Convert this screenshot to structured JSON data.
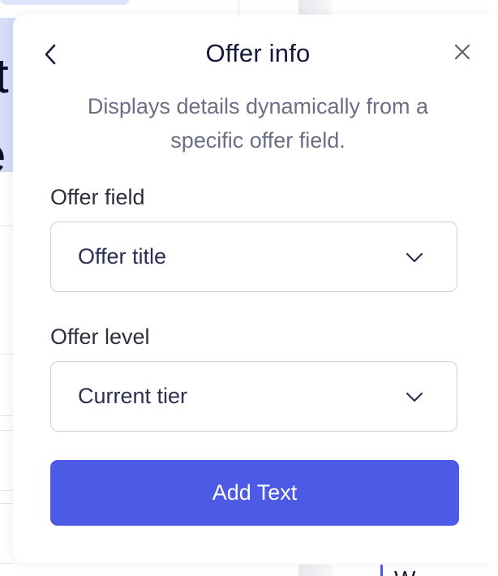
{
  "background": {
    "heading_fragment_1": "rt",
    "heading_fragment_2": "e",
    "bottom_fragment": "W"
  },
  "panel": {
    "title": "Offer info",
    "description": "Displays details dynamically from a specific offer field.",
    "back_icon": "chevron-left-icon",
    "close_icon": "close-icon"
  },
  "fields": {
    "offer_field": {
      "label": "Offer field",
      "value": "Offer title",
      "icon": "chevron-down-icon"
    },
    "offer_level": {
      "label": "Offer level",
      "value": "Current tier",
      "icon": "chevron-down-icon"
    }
  },
  "actions": {
    "add_text_label": "Add Text"
  },
  "colors": {
    "accent": "#4c5ae5",
    "title": "#15173a",
    "muted_text": "#6b6f85",
    "border": "#cfd0d8"
  }
}
